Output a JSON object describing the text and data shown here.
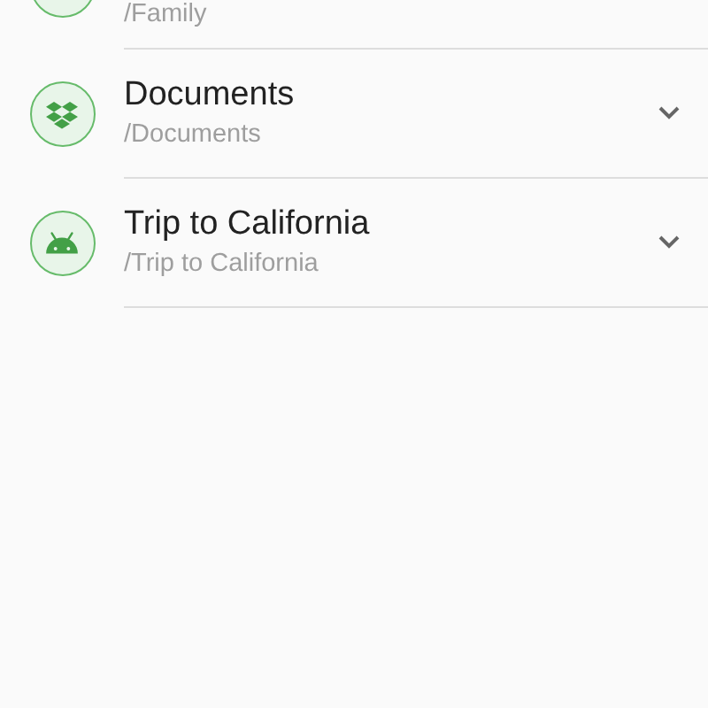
{
  "folders": [
    {
      "path": "/Family"
    },
    {
      "kind": "dropbox",
      "title": "Documents",
      "path": "/Documents",
      "expanded": false
    },
    {
      "kind": "android",
      "title": "Trip to California",
      "path": "/Trip to California",
      "expanded": false
    }
  ]
}
